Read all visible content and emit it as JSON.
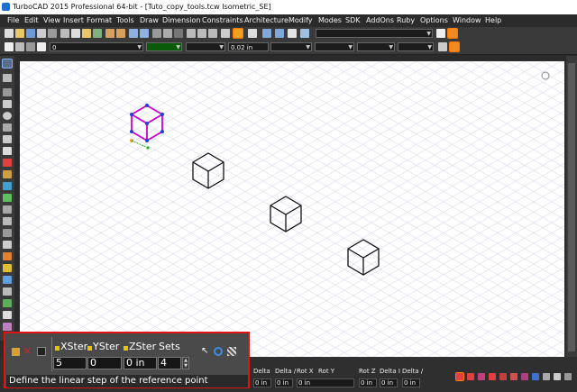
{
  "window": {
    "title": "TurboCAD 2015 Professional 64-bit - [Tuto_copy_tools.tcw Isometric_SE]"
  },
  "menu": {
    "items": [
      "File",
      "Edit",
      "View",
      "Insert",
      "Format",
      "Tools",
      "Draw",
      "Dimension",
      "Constraints",
      "Architecture",
      "Modify",
      "Modes",
      "SDK",
      "AddOns",
      "Ruby",
      "Options",
      "Window",
      "Help"
    ]
  },
  "toolbar": {
    "layer_value": "0",
    "line_width_value": "0.02 in"
  },
  "inspector": {
    "fields": [
      {
        "label": "XStep",
        "shown": "XSter",
        "value": "5"
      },
      {
        "label": "YStep",
        "shown": "YSter",
        "value": "0"
      },
      {
        "label": "ZStep",
        "shown": "ZSter",
        "value": "0 in"
      },
      {
        "label": "Sets",
        "shown": "Sets",
        "value": "4"
      }
    ],
    "prompt": "Define the linear step of the reference point"
  },
  "coordinate_bar": {
    "columns": [
      {
        "label": "Delta",
        "value": "0 in"
      },
      {
        "label": "Delta /",
        "value": "0 in"
      },
      {
        "label": "Rot X",
        "value": "0 in"
      },
      {
        "label": "Rot Y",
        "value": ""
      },
      {
        "label": "Rot Z",
        "value": "0 in"
      },
      {
        "label": "Delta I",
        "value": "0 in"
      },
      {
        "label": "Delta /",
        "value": "0 in"
      }
    ]
  },
  "colors": {
    "selection": "#cc00cc",
    "highlight_border": "#e01212",
    "grid": "#c9c9dd",
    "ui_dark": "#2b2b2b"
  }
}
